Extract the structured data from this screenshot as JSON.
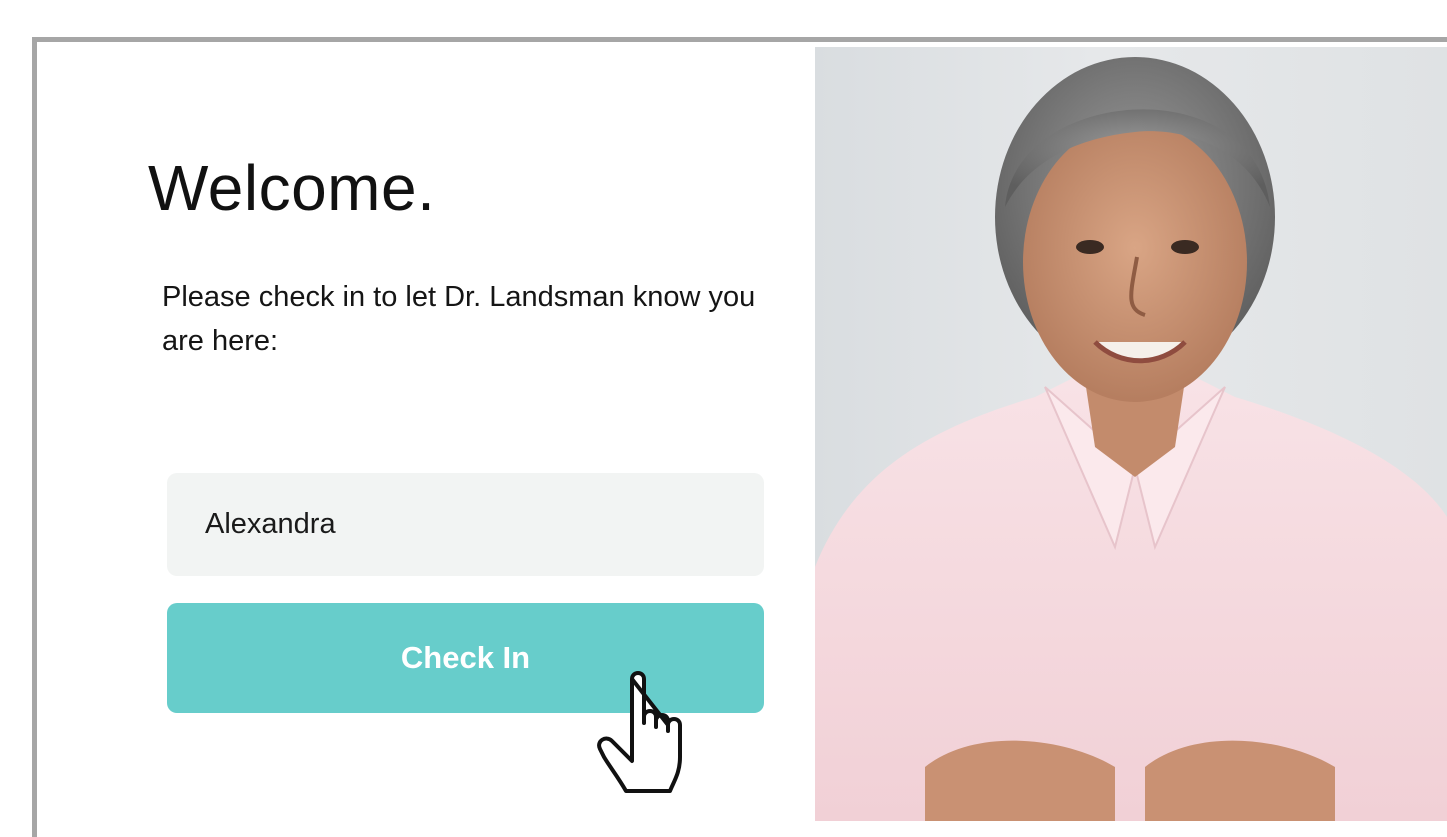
{
  "page": {
    "title": "Welcome.",
    "instructions": "Please check in to let Dr. Landsman know you are here:"
  },
  "form": {
    "name_value": "Alexandra",
    "checkin_label": "Check In"
  },
  "colors": {
    "button": "#67cdcb",
    "input_bg": "#f2f4f3",
    "frame_border": "#a6a6a6"
  },
  "icons": {
    "cursor": "hand-pointer-icon"
  },
  "photo": {
    "subject": "smiling elderly woman in pink shirt"
  }
}
